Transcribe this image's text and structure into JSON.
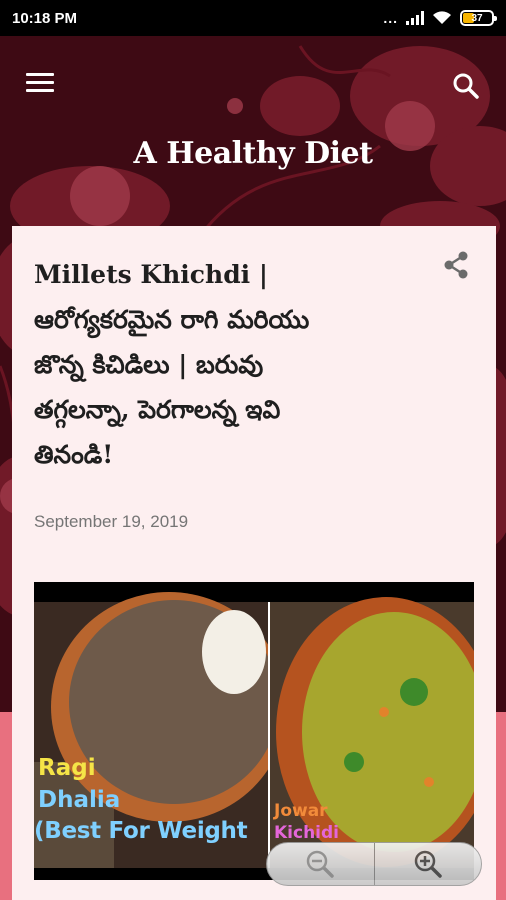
{
  "status_bar": {
    "time": "10:18 PM",
    "dots": "...",
    "battery_level": "37"
  },
  "header": {
    "menu_icon": "hamburger-menu-icon",
    "search_icon": "search-icon",
    "site_title": "A Healthy Diet",
    "background_color": "#3e0a14",
    "accent_color": "#e8707f"
  },
  "post": {
    "title_lines": [
      "Millets Khichdi |",
      "ఆరోగ్యకరమైన రాగి మరియు",
      "జొన్న కిచిడిలు | బరువు",
      "తగ్గలన్నా, పెరగాలన్న ఇవి",
      "తినండి!"
    ],
    "share_icon": "share-icon",
    "date": "September 19, 2019",
    "thumbnail": {
      "left_label_1": "Ragi",
      "left_label_2": "Dhalia",
      "left_label_3": "(Best For Weight",
      "right_label_1": "Jowar",
      "right_label_2": "Kichidi"
    }
  },
  "zoom_controls": {
    "zoom_out_icon": "zoom-out-icon",
    "zoom_in_icon": "zoom-in-icon"
  }
}
